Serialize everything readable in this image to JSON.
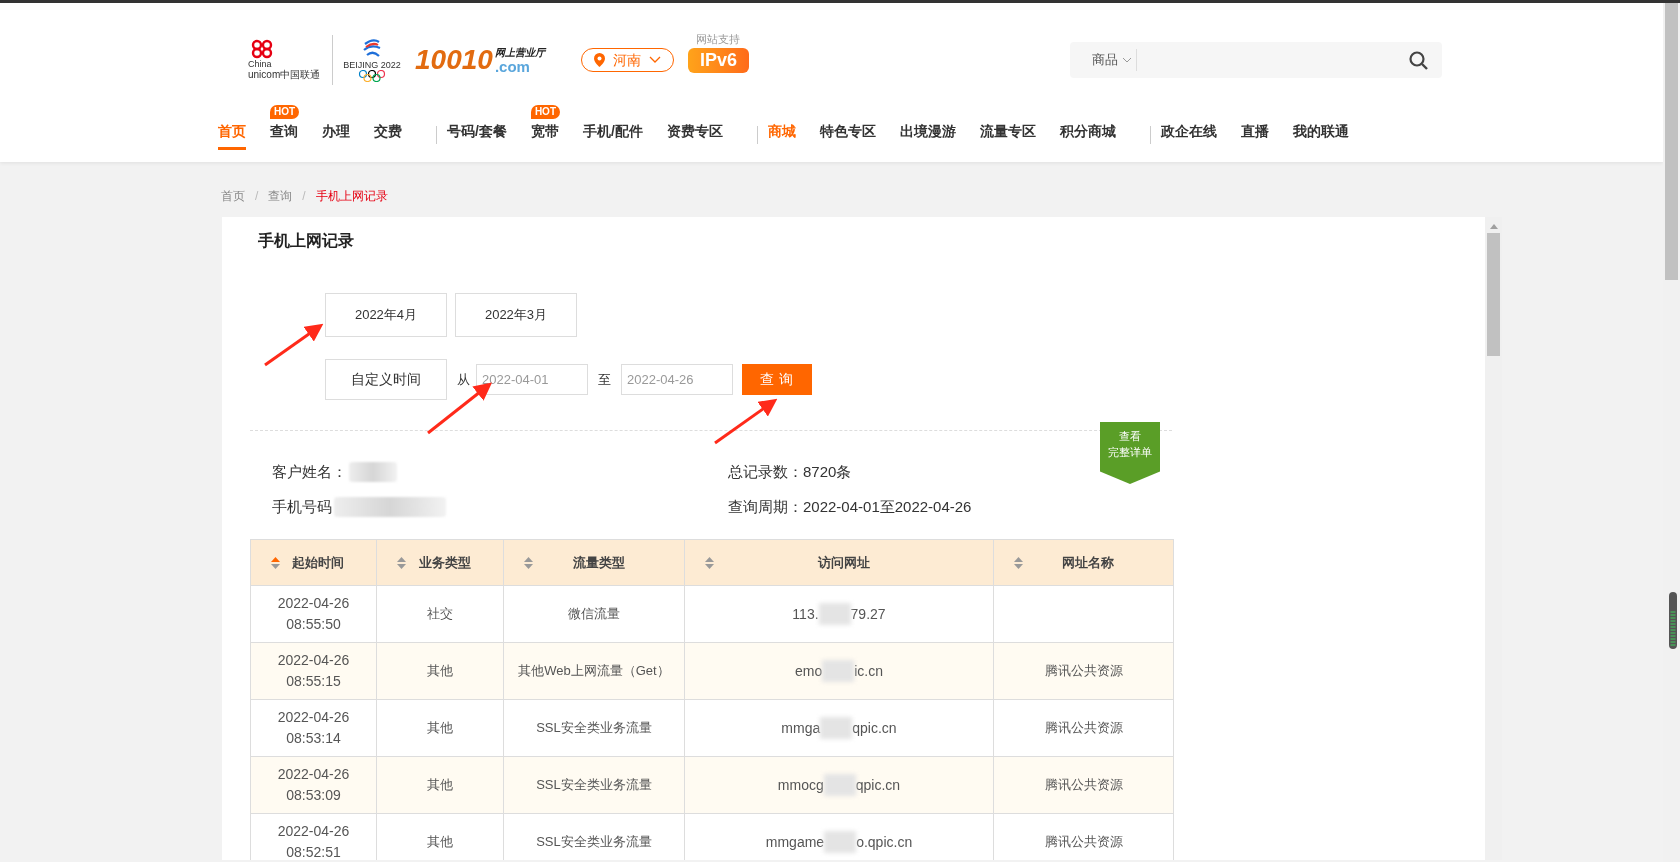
{
  "logo": {
    "brand_en": "China",
    "brand_en2": "unicom中国联通",
    "games": "BEIJING 2022",
    "number": "10010",
    "subtitle": "网上营业厅",
    "domain": ".com"
  },
  "location": {
    "label": "河南"
  },
  "ipv6": {
    "caption": "网站支持",
    "label": "IPv6"
  },
  "search": {
    "category": "商品"
  },
  "nav": [
    {
      "kind": "link",
      "label": "首页",
      "selected": true,
      "highlight": false
    },
    {
      "kind": "link",
      "label": "查询",
      "selected": false,
      "highlight": false,
      "badge": "HOT"
    },
    {
      "kind": "link",
      "label": "办理",
      "selected": false,
      "highlight": false
    },
    {
      "kind": "link",
      "label": "交费",
      "selected": false,
      "highlight": false
    },
    {
      "kind": "divider"
    },
    {
      "kind": "link",
      "label": "号码/套餐",
      "selected": false,
      "highlight": false
    },
    {
      "kind": "link",
      "label": "宽带",
      "selected": false,
      "highlight": false,
      "badge": "HOT"
    },
    {
      "kind": "link",
      "label": "手机/配件",
      "selected": false,
      "highlight": false
    },
    {
      "kind": "link",
      "label": "资费专区",
      "selected": false,
      "highlight": false
    },
    {
      "kind": "divider"
    },
    {
      "kind": "link",
      "label": "商城",
      "selected": false,
      "highlight": true
    },
    {
      "kind": "link",
      "label": "特色专区",
      "selected": false,
      "highlight": false
    },
    {
      "kind": "link",
      "label": "出境漫游",
      "selected": false,
      "highlight": false
    },
    {
      "kind": "link",
      "label": "流量专区",
      "selected": false,
      "highlight": false
    },
    {
      "kind": "link",
      "label": "积分商城",
      "selected": false,
      "highlight": false
    },
    {
      "kind": "divider"
    },
    {
      "kind": "link",
      "label": "政企在线",
      "selected": false,
      "highlight": false
    },
    {
      "kind": "link",
      "label": "直播",
      "selected": false,
      "highlight": false
    },
    {
      "kind": "link",
      "label": "我的联通",
      "selected": false,
      "highlight": false
    }
  ],
  "breadcrumb": [
    {
      "label": "首页",
      "current": false
    },
    {
      "label": "查询",
      "current": false
    },
    {
      "label": "手机上网记录",
      "current": true
    }
  ],
  "breadcrumb_separator": "/",
  "page_title": "手机上网记录",
  "months": [
    {
      "label": "2022年4月"
    },
    {
      "label": "2022年3月"
    }
  ],
  "custom": {
    "label": "自定义时间",
    "from_label": "从",
    "from_placeholder": "2022-04-01",
    "to_label": "至",
    "to_placeholder": "2022-04-26",
    "button": "查 询"
  },
  "detail_ribbon": {
    "line1": "查看",
    "line2": "完整详单"
  },
  "info": [
    {
      "label": "客户姓名：",
      "redacted": true
    },
    {
      "label": "手机号码",
      "redacted": true
    }
  ],
  "summary": [
    {
      "label": "总记录数：",
      "value": "8720条"
    },
    {
      "label": "查询周期：",
      "value": "2022-04-01至2022-04-26"
    }
  ],
  "table": {
    "columns": [
      {
        "label": "起始时间",
        "sorted": true
      },
      {
        "label": "业务类型",
        "sorted": false
      },
      {
        "label": "流量类型",
        "sorted": false
      },
      {
        "label": "访问网址",
        "sorted": false
      },
      {
        "label": "网址名称",
        "sorted": false
      }
    ],
    "rows": [
      {
        "date": "2022-04-26",
        "time": "08:55:50",
        "service": "社交",
        "traffic": "微信流量",
        "url_start": "113.",
        "url_end": "79.27"
      },
      {
        "date": "2022-04-26",
        "time": "08:55:15",
        "service": "其他",
        "traffic": "其他Web上网流量（Get）",
        "url_start": "emo",
        "url_end": "ic.cn",
        "site": "腾讯公共资源"
      },
      {
        "date": "2022-04-26",
        "time": "08:53:14",
        "service": "其他",
        "traffic": "SSL安全类业务流量",
        "url_start": "mmga",
        "url_end": "qpic.cn",
        "site": "腾讯公共资源"
      },
      {
        "date": "2022-04-26",
        "time": "08:53:09",
        "service": "其他",
        "traffic": "SSL安全类业务流量",
        "url_start": "mmocg",
        "url_end": "qpic.cn",
        "site": "腾讯公共资源"
      },
      {
        "date": "2022-04-26",
        "time": "08:52:51",
        "service": "其他",
        "traffic": "SSL安全类业务流量",
        "url_start": "mmgame",
        "url_end": "o.qpic.cn",
        "site": "腾讯公共资源"
      }
    ]
  }
}
